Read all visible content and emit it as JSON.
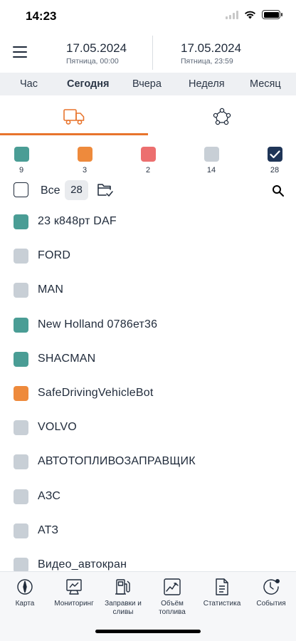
{
  "status": {
    "time": "14:23"
  },
  "header": {
    "date_from": "17.05.2024",
    "date_from_sub": "Пятница, 00:00",
    "date_to": "17.05.2024",
    "date_to_sub": "Пятница, 23:59"
  },
  "period_tabs": [
    {
      "label": "Час",
      "active": false
    },
    {
      "label": "Сегодня",
      "active": true
    },
    {
      "label": "Вчера",
      "active": false
    },
    {
      "label": "Неделя",
      "active": false
    },
    {
      "label": "Месяц",
      "active": false
    }
  ],
  "view_tabs": [
    {
      "icon": "truck-icon",
      "active": true
    },
    {
      "icon": "network-icon",
      "active": false
    }
  ],
  "colors": {
    "teal": "#4a9d95",
    "orange": "#ee8a3c",
    "red": "#ec6f6f",
    "gray": "#c8cfd6",
    "navy": "#1f3557",
    "accent": "#e8742c"
  },
  "status_filters": [
    {
      "color": "teal",
      "count": "9"
    },
    {
      "color": "orange",
      "count": "3"
    },
    {
      "color": "red",
      "count": "2"
    },
    {
      "color": "gray",
      "count": "14"
    },
    {
      "color": "navy",
      "count": "28",
      "checked": true
    }
  ],
  "select_all": {
    "label": "Все",
    "count": "28"
  },
  "vehicles": [
    {
      "name": "23 к848рт DAF",
      "color": "teal"
    },
    {
      "name": "FORD",
      "color": "gray"
    },
    {
      "name": "MAN",
      "color": "gray"
    },
    {
      "name": "New Holland 0786ет36",
      "color": "teal"
    },
    {
      "name": "SHACMAN",
      "color": "teal"
    },
    {
      "name": "SafeDrivingVehicleBot",
      "color": "orange"
    },
    {
      "name": "VOLVO",
      "color": "gray"
    },
    {
      "name": "АВТОТОПЛИВОЗАПРАВЩИК",
      "color": "gray"
    },
    {
      "name": "АЗС",
      "color": "gray"
    },
    {
      "name": "АТЗ",
      "color": "gray"
    },
    {
      "name": "Видео_автокран",
      "color": "gray"
    }
  ],
  "bottom_nav": [
    {
      "label": "Карта",
      "icon": "compass-icon"
    },
    {
      "label": "Мониторинг",
      "icon": "monitoring-icon"
    },
    {
      "label": "Заправки и сливы",
      "icon": "fuel-station-icon"
    },
    {
      "label": "Объём топлива",
      "icon": "fuel-volume-chart-icon"
    },
    {
      "label": "Статистика",
      "icon": "document-icon"
    },
    {
      "label": "События",
      "icon": "events-clock-icon"
    }
  ]
}
